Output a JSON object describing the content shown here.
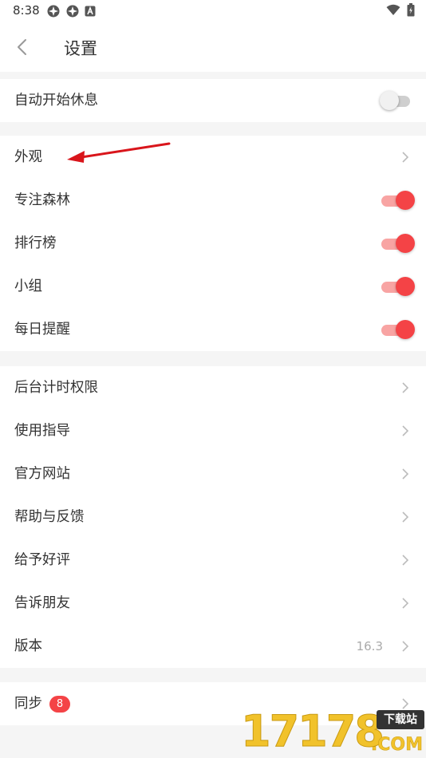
{
  "status": {
    "time": "8:38"
  },
  "header": {
    "title": "设置"
  },
  "rows": [
    {
      "label": "自动开始休息",
      "toggle": "off"
    },
    {
      "label": "外观"
    },
    {
      "label": "专注森林",
      "toggle": "on"
    },
    {
      "label": "排行榜",
      "toggle": "on"
    },
    {
      "label": "小组",
      "toggle": "on"
    },
    {
      "label": "每日提醒",
      "toggle": "on"
    },
    {
      "label": "后台计时权限"
    },
    {
      "label": "使用指导"
    },
    {
      "label": "官方网站"
    },
    {
      "label": "帮助与反馈"
    },
    {
      "label": "给予好评"
    },
    {
      "label": "告诉朋友"
    },
    {
      "label": "版本",
      "value": "16.3"
    },
    {
      "label": "同步",
      "badge": "8"
    }
  ],
  "watermark": {
    "digits": "17178",
    "tag": "下载站",
    "domain": ".COM"
  },
  "colors": {
    "accent": "#f44346",
    "track_on": "#f8a4a3",
    "arrow": "#d9151b"
  }
}
